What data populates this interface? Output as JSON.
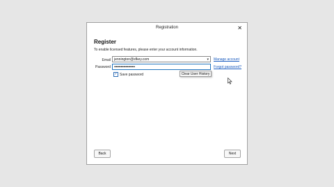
{
  "dialog": {
    "title": "Registration",
    "close_glyph": "✕",
    "heading": "Register",
    "instructions": "To enable licensed features, please enter your account information."
  },
  "form": {
    "email_label": "Email",
    "email_value": "jennington@sfkey.com",
    "password_label": "Password",
    "password_value": "••••••••••••••••••••••",
    "manage_account": "Manage account",
    "forgot_password": "Forgot password?",
    "save_password": "Save password",
    "save_password_checked": true,
    "check_glyph": "✓",
    "dropdown_glyph": "▾"
  },
  "context_menu": {
    "item": "Clear User History"
  },
  "buttons": {
    "back": "Back",
    "next": "Next"
  },
  "icons": {
    "close": "close-icon",
    "dropdown": "chevron-down-icon",
    "cursor": "mouse-pointer-icon"
  }
}
